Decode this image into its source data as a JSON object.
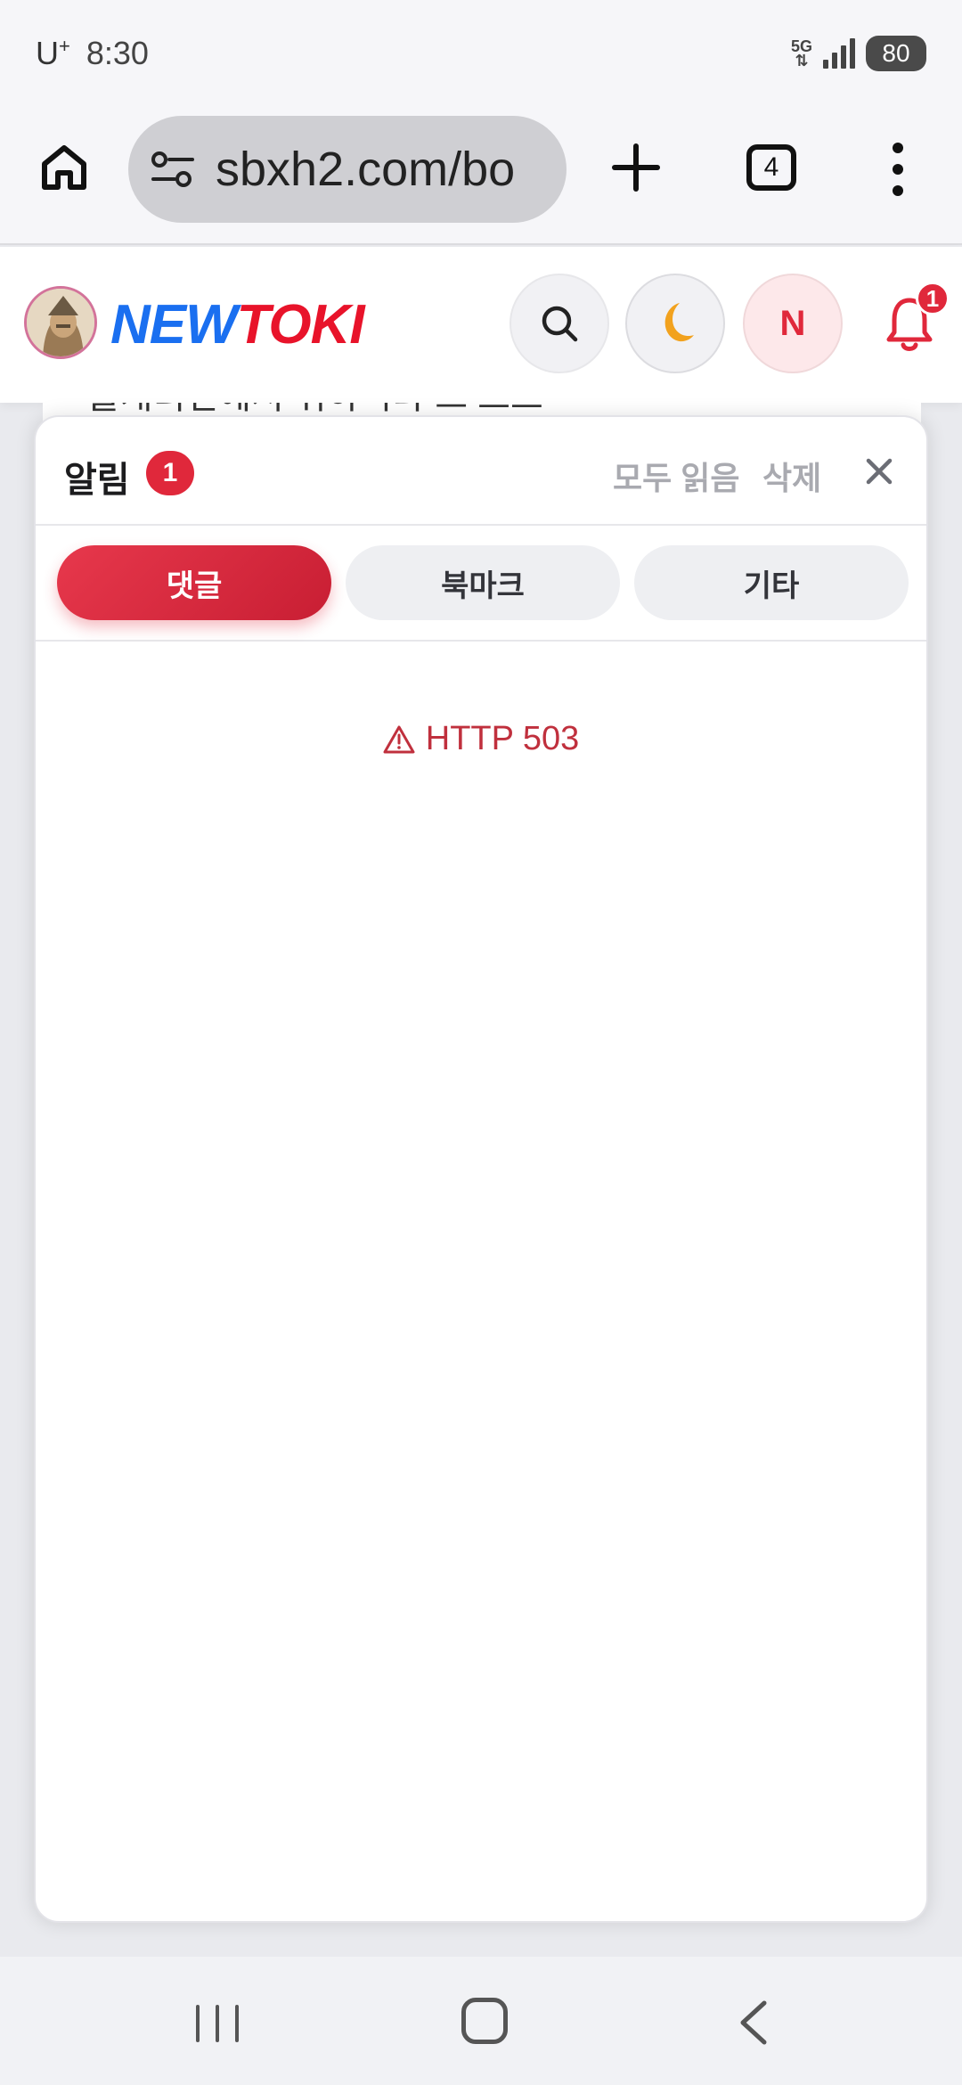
{
  "status_bar": {
    "carrier": "U",
    "carrier_sup": "+",
    "time": "8:30",
    "network": "5G",
    "battery": "80"
  },
  "browser": {
    "url": "sbxh2.com/bo",
    "tab_count": "4"
  },
  "site": {
    "logo_part1": "NEW",
    "logo_part2": "TOKI",
    "profile_initial": "N",
    "bell_badge": "1",
    "background_text": "블캐리언에서 위하니다 드 르르"
  },
  "notifications": {
    "title": "알림",
    "count": "1",
    "mark_all_read": "모두 읽음",
    "delete_all": "삭제",
    "tabs": [
      {
        "label": "댓글",
        "active": true
      },
      {
        "label": "북마크",
        "active": false
      },
      {
        "label": "기타",
        "active": false
      }
    ],
    "error_text": "HTTP 503"
  },
  "colors": {
    "accent": "#e0283b",
    "logo_blue": "#1a6ff0",
    "logo_red": "#e8132a",
    "error": "#c0303d"
  },
  "icons": {
    "home": "home-icon",
    "site_settings": "tune-icon",
    "new_tab": "plus-icon",
    "menu": "more-vertical-icon",
    "search": "search-icon",
    "theme": "moon-icon",
    "notifications": "bell-icon",
    "close": "close-icon",
    "warning": "warning-icon"
  }
}
